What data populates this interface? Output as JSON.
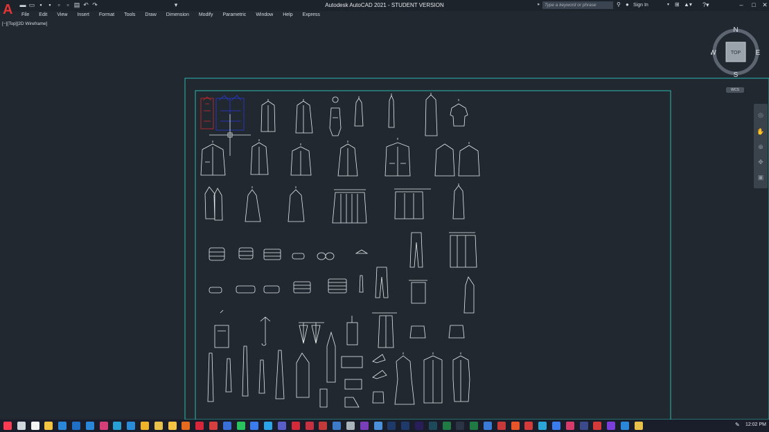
{
  "titlebar": {
    "app_title": "Autodesk AutoCAD 2021 - STUDENT VERSION",
    "search_placeholder": "Type a keyword or phrase",
    "sign_in": "Sign In",
    "quick_access": [
      "new-icon",
      "open-icon",
      "save-icon",
      "save-as-icon",
      "plot-preview-icon",
      "publish-icon",
      "print-icon",
      "undo-icon",
      "redo-icon",
      "customize-icon"
    ]
  },
  "menubar": [
    "File",
    "Edit",
    "View",
    "Insert",
    "Format",
    "Tools",
    "Draw",
    "Dimension",
    "Modify",
    "Parametric",
    "Window",
    "Help",
    "Express"
  ],
  "viewport": {
    "label": "[−][Top][2D Wireframe]"
  },
  "viewcube": {
    "n": "N",
    "s": "S",
    "e": "E",
    "w": "W",
    "face": "TOP",
    "wcs": "WCS"
  },
  "taskbar": {
    "time": "12:02 PM",
    "apps": [
      {
        "name": "start",
        "color": "#ff3b54"
      },
      {
        "name": "search",
        "color": "#cfd6dd"
      },
      {
        "name": "store",
        "color": "#f2f2f2"
      },
      {
        "name": "file-explorer",
        "color": "#f4c542"
      },
      {
        "name": "onedrive",
        "color": "#2b88d8"
      },
      {
        "name": "calculator",
        "color": "#1f6fc4"
      },
      {
        "name": "mail",
        "color": "#2b88d8"
      },
      {
        "name": "photos",
        "color": "#d43f7a"
      },
      {
        "name": "edge",
        "color": "#27a0d6"
      },
      {
        "name": "ie",
        "color": "#2a8bd8"
      },
      {
        "name": "paint",
        "color": "#f0b429"
      },
      {
        "name": "chrome",
        "color": "#e8c14a"
      },
      {
        "name": "files",
        "color": "#f4c542"
      },
      {
        "name": "firefox",
        "color": "#e66b1f"
      },
      {
        "name": "opera",
        "color": "#d8263a"
      },
      {
        "name": "app-red",
        "color": "#d44040"
      },
      {
        "name": "app-blue",
        "color": "#3b6fd8"
      },
      {
        "name": "whatsapp",
        "color": "#29c25f"
      },
      {
        "name": "zoom",
        "color": "#3b7bf0"
      },
      {
        "name": "skype",
        "color": "#2aa6e8"
      },
      {
        "name": "teams",
        "color": "#5a5fc8"
      },
      {
        "name": "autocad",
        "color": "#d42a3a"
      },
      {
        "name": "autocad-2",
        "color": "#c63040"
      },
      {
        "name": "autocad-3",
        "color": "#c23a3a"
      },
      {
        "name": "revit",
        "color": "#3d7bc8"
      },
      {
        "name": "app-grey",
        "color": "#aab2bb"
      },
      {
        "name": "onenote",
        "color": "#7a3fb8"
      },
      {
        "name": "app-blue-2",
        "color": "#4a8fd8"
      },
      {
        "name": "photoshop",
        "color": "#1e3a6a"
      },
      {
        "name": "photoshop-2",
        "color": "#1e3a6a"
      },
      {
        "name": "premiere",
        "color": "#2a1e5a"
      },
      {
        "name": "audition",
        "color": "#1c4a5a"
      },
      {
        "name": "excel",
        "color": "#1f7a43"
      },
      {
        "name": "app-dark",
        "color": "#2a3444"
      },
      {
        "name": "excel-2",
        "color": "#1f7a43"
      },
      {
        "name": "app-blue-3",
        "color": "#3b7bd8"
      },
      {
        "name": "acrobat",
        "color": "#c83a3a"
      },
      {
        "name": "app-orange",
        "color": "#e8552a"
      },
      {
        "name": "app-red-2",
        "color": "#d43a3a"
      },
      {
        "name": "app-cyan",
        "color": "#2aa6d8"
      },
      {
        "name": "app-blue-4",
        "color": "#3b7bf0"
      },
      {
        "name": "app-magenta",
        "color": "#d83a6a"
      },
      {
        "name": "app-navy",
        "color": "#3a4a8a"
      },
      {
        "name": "app-red-3",
        "color": "#d43a3a"
      },
      {
        "name": "app-purple",
        "color": "#7a3fd8"
      },
      {
        "name": "app-blue-5",
        "color": "#2b88d8"
      },
      {
        "name": "app-yellow",
        "color": "#e8c14a"
      }
    ]
  }
}
